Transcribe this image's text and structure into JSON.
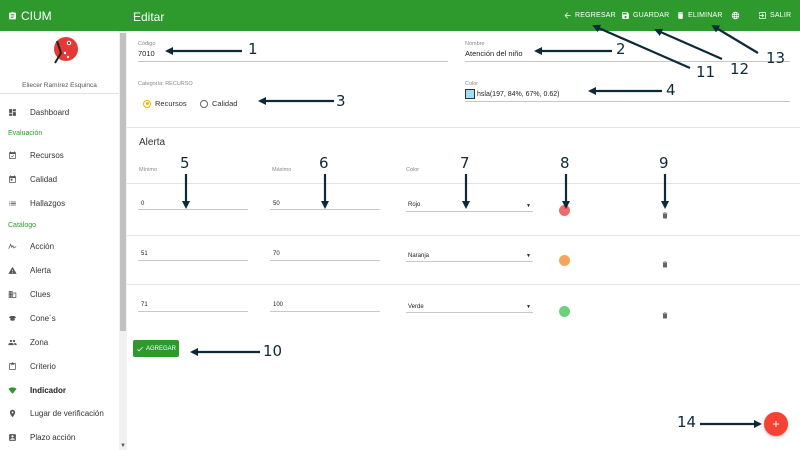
{
  "app": {
    "title": "CIUM",
    "page_title": "Editar"
  },
  "toolbar": {
    "back_label": "REGRESAR",
    "save_label": "GUARDAR",
    "delete_label": "ELIMINAR",
    "exit_label": "SALIR"
  },
  "sidebar": {
    "user_name": "Eliecer Ramírez Esquinca",
    "section_eval": "Evaluación",
    "section_catalog": "Catálogo",
    "items": {
      "dashboard": "Dashboard",
      "recursos": "Recursos",
      "calidad": "Calidad",
      "hallazgos": "Hallazgos",
      "accion": "Acción",
      "alerta": "Alerta",
      "clues": "Clues",
      "cones": "Cone´s",
      "zona": "Zona",
      "criterio": "Criterio",
      "indicador": "Indicador",
      "lugar": "Lugar de verificación",
      "plazo": "Plazo acción"
    }
  },
  "form": {
    "codigo_label": "Código",
    "codigo_value": "7010",
    "nombre_label": "Nombre",
    "nombre_value": "Atención del niño",
    "categoria_label": "Categoría: RECURSO",
    "radio_recursos": "Recursos",
    "radio_calidad": "Calidad",
    "color_label": "Color",
    "color_value": "hsla(197, 84%, 67%, 0.62)"
  },
  "alerts": {
    "title": "Alerta",
    "col_min": "Mínimo",
    "col_max": "Máximo",
    "col_color": "Color",
    "rows": [
      {
        "min": "0",
        "max": "50",
        "color": "Rojo",
        "dot": "#f06a6a"
      },
      {
        "min": "51",
        "max": "70",
        "color": "Naranja",
        "dot": "#f5a55a"
      },
      {
        "min": "71",
        "max": "100",
        "color": "Verde",
        "dot": "#6ad27a"
      }
    ],
    "add_label": "AGREGAR"
  },
  "fab_label": "+",
  "annotations": [
    "1",
    "2",
    "3",
    "4",
    "5",
    "6",
    "7",
    "8",
    "9",
    "10",
    "11",
    "12",
    "13",
    "14"
  ]
}
